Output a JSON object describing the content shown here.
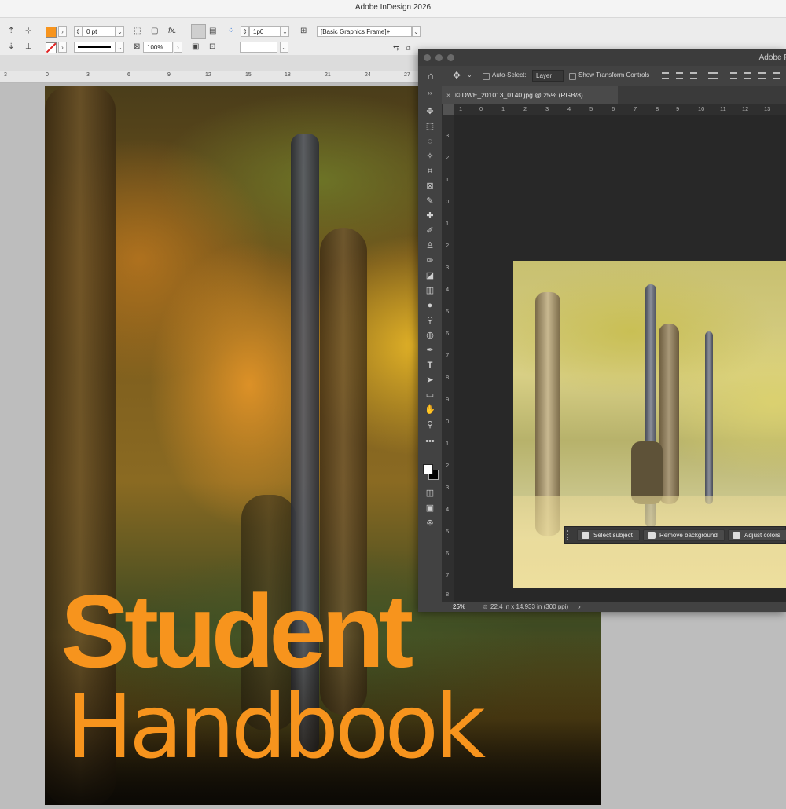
{
  "indesign": {
    "window_title": "Adobe InDesign 2026",
    "control_panel": {
      "stroke_weight": "0 pt",
      "scale_percent": "100%",
      "gutter_value": "1p0",
      "object_style": "[Basic Graphics Frame]+",
      "fx_label": "fx."
    },
    "ruler_numbers": [
      "3",
      "0",
      "3",
      "6",
      "9",
      "12",
      "15",
      "18",
      "21",
      "24",
      "27"
    ]
  },
  "document": {
    "headline_line1": "Student",
    "headline_line2": "Handbook",
    "accent_color": "#f7941d"
  },
  "photoshop": {
    "window_title": "Adobe P",
    "options_bar": {
      "home_icon": "home-icon",
      "auto_select_label": "Auto-Select:",
      "layer_dropdown": "Layer",
      "show_transform_label": "Show Transform Controls"
    },
    "document_tab": "© DWE_201013_0140.jpg @ 25% (RGB/8)",
    "ruler_h_numbers": [
      "1",
      "0",
      "1",
      "2",
      "3",
      "4",
      "5",
      "6",
      "7",
      "8",
      "9",
      "10",
      "11",
      "12",
      "13"
    ],
    "ruler_v_numbers": [
      "3",
      "2",
      "1",
      "0",
      "1",
      "2",
      "3",
      "4",
      "5",
      "6",
      "7",
      "8",
      "9",
      "0",
      "1",
      "2",
      "3",
      "4",
      "5",
      "6",
      "7",
      "8"
    ],
    "contextual_taskbar": {
      "select_subject": "Select subject",
      "remove_background": "Remove background",
      "adjust_colors": "Adjust colors"
    },
    "status": {
      "zoom": "25%",
      "doc_info": "22.4 in x 14.933 in (300 ppi)"
    }
  }
}
